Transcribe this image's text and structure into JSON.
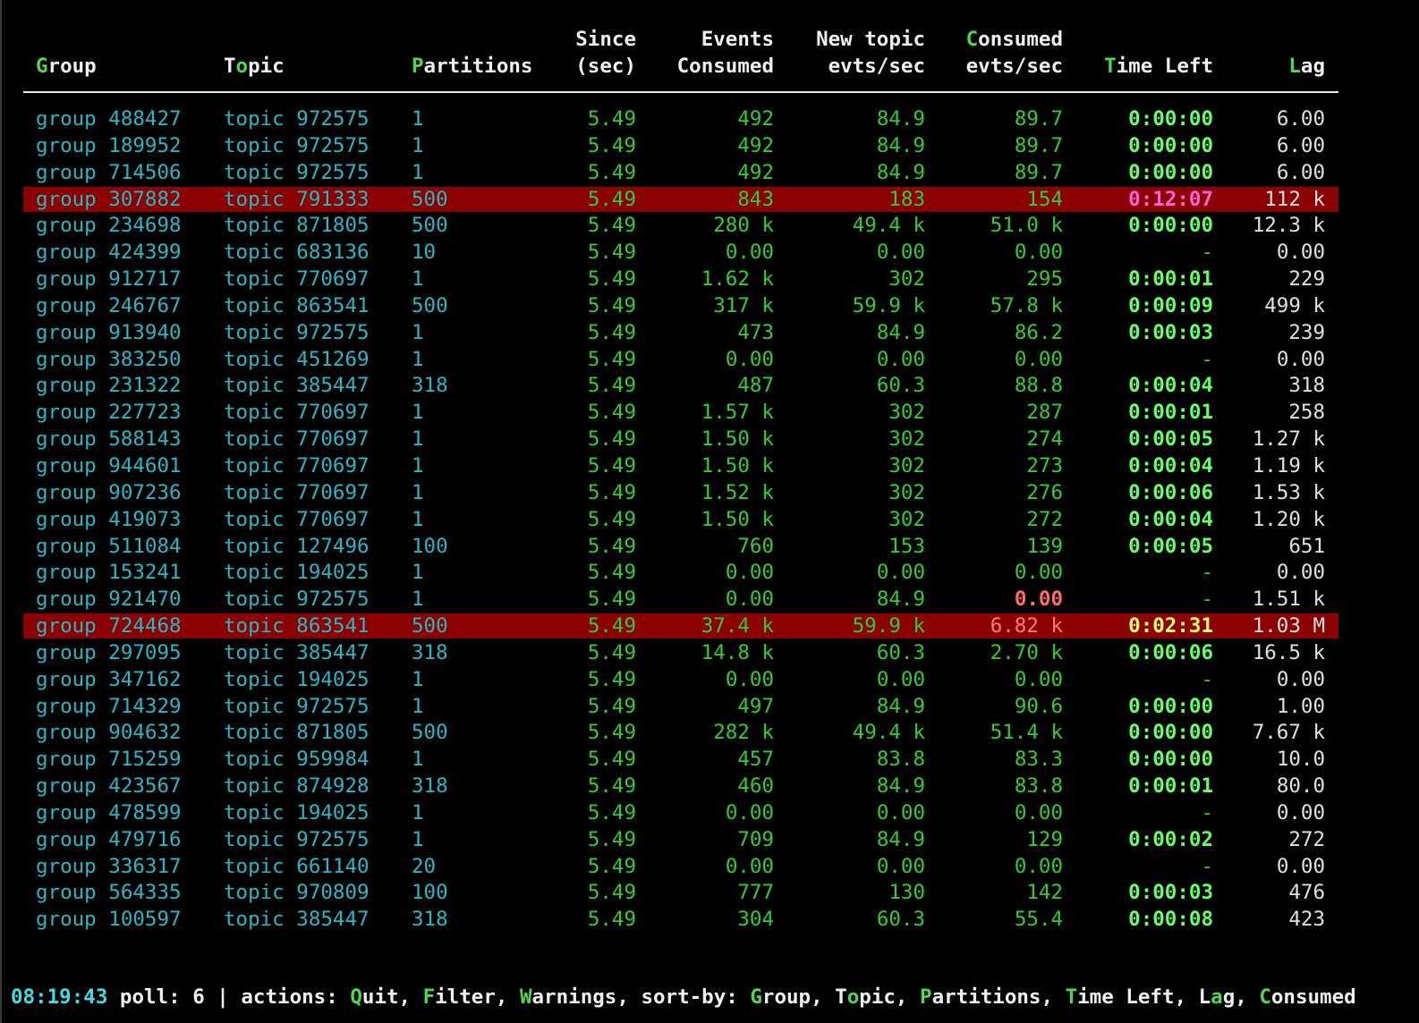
{
  "headers": {
    "group": "Group",
    "topic": "Topic",
    "partitions": "Partitions",
    "since_line1": "Since",
    "since_line2": "(sec)",
    "events_line1": "Events",
    "events_line2": "Consumed",
    "newtopic_line1": "New topic",
    "newtopic_line2": "evts/sec",
    "consumed_line1": "Consumed",
    "consumed_line2": "evts/sec",
    "timeleft": "Time Left",
    "lag": "Lag"
  },
  "rows": [
    {
      "group": "group 488427",
      "topic": "topic 972575",
      "partitions": "1",
      "since": "5.49",
      "events": "492",
      "new": "84.9",
      "consumed": "89.7",
      "timeleft": "0:00:00",
      "lag": "6.00",
      "warn": false
    },
    {
      "group": "group 189952",
      "topic": "topic 972575",
      "partitions": "1",
      "since": "5.49",
      "events": "492",
      "new": "84.9",
      "consumed": "89.7",
      "timeleft": "0:00:00",
      "lag": "6.00",
      "warn": false
    },
    {
      "group": "group 714506",
      "topic": "topic 972575",
      "partitions": "1",
      "since": "5.49",
      "events": "492",
      "new": "84.9",
      "consumed": "89.7",
      "timeleft": "0:00:00",
      "lag": "6.00",
      "warn": false
    },
    {
      "group": "group 307882",
      "topic": "topic 791333",
      "partitions": "500",
      "since": "5.49",
      "events": "843",
      "new": "183",
      "consumed": "154",
      "timeleft": "0:12:07",
      "lag": "112 k",
      "warn": true,
      "time_style": "magenta"
    },
    {
      "group": "group 234698",
      "topic": "topic 871805",
      "partitions": "500",
      "since": "5.49",
      "events": "280 k",
      "new": "49.4 k",
      "consumed": "51.0 k",
      "timeleft": "0:00:00",
      "lag": "12.3 k",
      "warn": false
    },
    {
      "group": "group 424399",
      "topic": "topic 683136",
      "partitions": "10",
      "since": "5.49",
      "events": "0.00",
      "new": "0.00",
      "consumed": "0.00",
      "timeleft": "-",
      "lag": "0.00",
      "warn": false
    },
    {
      "group": "group 912717",
      "topic": "topic 770697",
      "partitions": "1",
      "since": "5.49",
      "events": "1.62 k",
      "new": "302",
      "consumed": "295",
      "timeleft": "0:00:01",
      "lag": "229",
      "warn": false
    },
    {
      "group": "group 246767",
      "topic": "topic 863541",
      "partitions": "500",
      "since": "5.49",
      "events": "317 k",
      "new": "59.9 k",
      "consumed": "57.8 k",
      "timeleft": "0:00:09",
      "lag": "499 k",
      "warn": false
    },
    {
      "group": "group 913940",
      "topic": "topic 972575",
      "partitions": "1",
      "since": "5.49",
      "events": "473",
      "new": "84.9",
      "consumed": "86.2",
      "timeleft": "0:00:03",
      "lag": "239",
      "warn": false
    },
    {
      "group": "group 383250",
      "topic": "topic 451269",
      "partitions": "1",
      "since": "5.49",
      "events": "0.00",
      "new": "0.00",
      "consumed": "0.00",
      "timeleft": "-",
      "lag": "0.00",
      "warn": false
    },
    {
      "group": "group 231322",
      "topic": "topic 385447",
      "partitions": "318",
      "since": "5.49",
      "events": "487",
      "new": "60.3",
      "consumed": "88.8",
      "timeleft": "0:00:04",
      "lag": "318",
      "warn": false
    },
    {
      "group": "group 227723",
      "topic": "topic 770697",
      "partitions": "1",
      "since": "5.49",
      "events": "1.57 k",
      "new": "302",
      "consumed": "287",
      "timeleft": "0:00:01",
      "lag": "258",
      "warn": false
    },
    {
      "group": "group 588143",
      "topic": "topic 770697",
      "partitions": "1",
      "since": "5.49",
      "events": "1.50 k",
      "new": "302",
      "consumed": "274",
      "timeleft": "0:00:05",
      "lag": "1.27 k",
      "warn": false
    },
    {
      "group": "group 944601",
      "topic": "topic 770697",
      "partitions": "1",
      "since": "5.49",
      "events": "1.50 k",
      "new": "302",
      "consumed": "273",
      "timeleft": "0:00:04",
      "lag": "1.19 k",
      "warn": false
    },
    {
      "group": "group 907236",
      "topic": "topic 770697",
      "partitions": "1",
      "since": "5.49",
      "events": "1.52 k",
      "new": "302",
      "consumed": "276",
      "timeleft": "0:00:06",
      "lag": "1.53 k",
      "warn": false
    },
    {
      "group": "group 419073",
      "topic": "topic 770697",
      "partitions": "1",
      "since": "5.49",
      "events": "1.50 k",
      "new": "302",
      "consumed": "272",
      "timeleft": "0:00:04",
      "lag": "1.20 k",
      "warn": false
    },
    {
      "group": "group 511084",
      "topic": "topic 127496",
      "partitions": "100",
      "since": "5.49",
      "events": "760",
      "new": "153",
      "consumed": "139",
      "timeleft": "0:00:05",
      "lag": "651",
      "warn": false
    },
    {
      "group": "group 153241",
      "topic": "topic 194025",
      "partitions": "1",
      "since": "5.49",
      "events": "0.00",
      "new": "0.00",
      "consumed": "0.00",
      "timeleft": "-",
      "lag": "0.00",
      "warn": false
    },
    {
      "group": "group 921470",
      "topic": "topic 972575",
      "partitions": "1",
      "since": "5.49",
      "events": "0.00",
      "new": "84.9",
      "consumed": "0.00",
      "timeleft": "-",
      "lag": "1.51 k",
      "warn": false,
      "consumed_style": "alert"
    },
    {
      "group": "group 724468",
      "topic": "topic 863541",
      "partitions": "500",
      "since": "5.49",
      "events": "37.4 k",
      "new": "59.9 k",
      "consumed": "6.82 k",
      "timeleft": "0:02:31",
      "lag": "1.03 M",
      "warn": true,
      "time_style": "yellow",
      "consumed_style": "warnred"
    },
    {
      "group": "group 297095",
      "topic": "topic 385447",
      "partitions": "318",
      "since": "5.49",
      "events": "14.8 k",
      "new": "60.3",
      "consumed": "2.70 k",
      "timeleft": "0:00:06",
      "lag": "16.5 k",
      "warn": false
    },
    {
      "group": "group 347162",
      "topic": "topic 194025",
      "partitions": "1",
      "since": "5.49",
      "events": "0.00",
      "new": "0.00",
      "consumed": "0.00",
      "timeleft": "-",
      "lag": "0.00",
      "warn": false
    },
    {
      "group": "group 714329",
      "topic": "topic 972575",
      "partitions": "1",
      "since": "5.49",
      "events": "497",
      "new": "84.9",
      "consumed": "90.6",
      "timeleft": "0:00:00",
      "lag": "1.00",
      "warn": false
    },
    {
      "group": "group 904632",
      "topic": "topic 871805",
      "partitions": "500",
      "since": "5.49",
      "events": "282 k",
      "new": "49.4 k",
      "consumed": "51.4 k",
      "timeleft": "0:00:00",
      "lag": "7.67 k",
      "warn": false
    },
    {
      "group": "group 715259",
      "topic": "topic 959984",
      "partitions": "1",
      "since": "5.49",
      "events": "457",
      "new": "83.8",
      "consumed": "83.3",
      "timeleft": "0:00:00",
      "lag": "10.0",
      "warn": false
    },
    {
      "group": "group 423567",
      "topic": "topic 874928",
      "partitions": "318",
      "since": "5.49",
      "events": "460",
      "new": "84.9",
      "consumed": "83.8",
      "timeleft": "0:00:01",
      "lag": "80.0",
      "warn": false
    },
    {
      "group": "group 478599",
      "topic": "topic 194025",
      "partitions": "1",
      "since": "5.49",
      "events": "0.00",
      "new": "0.00",
      "consumed": "0.00",
      "timeleft": "-",
      "lag": "0.00",
      "warn": false
    },
    {
      "group": "group 479716",
      "topic": "topic 972575",
      "partitions": "1",
      "since": "5.49",
      "events": "709",
      "new": "84.9",
      "consumed": "129",
      "timeleft": "0:00:02",
      "lag": "272",
      "warn": false
    },
    {
      "group": "group 336317",
      "topic": "topic 661140",
      "partitions": "20",
      "since": "5.49",
      "events": "0.00",
      "new": "0.00",
      "consumed": "0.00",
      "timeleft": "-",
      "lag": "0.00",
      "warn": false
    },
    {
      "group": "group 564335",
      "topic": "topic 970809",
      "partitions": "100",
      "since": "5.49",
      "events": "777",
      "new": "130",
      "consumed": "142",
      "timeleft": "0:00:03",
      "lag": "476",
      "warn": false
    },
    {
      "group": "group 100597",
      "topic": "topic 385447",
      "partitions": "318",
      "since": "5.49",
      "events": "304",
      "new": "60.3",
      "consumed": "55.4",
      "timeleft": "0:00:08",
      "lag": "423",
      "warn": false
    }
  ],
  "status": {
    "clock": "08:19:43",
    "poll_label": "poll: 6",
    "separator": "|",
    "actions_label": "actions:",
    "actions": [
      {
        "key": "Q",
        "rest": "uit"
      },
      {
        "key": "F",
        "rest": "ilter"
      },
      {
        "key": "W",
        "rest": "arnings"
      }
    ],
    "sort_label": "sort-by:",
    "sorts": [
      {
        "pre": "",
        "key": "G",
        "rest": "roup"
      },
      {
        "pre": "T",
        "key": "o",
        "rest": "pic"
      },
      {
        "pre": "",
        "key": "P",
        "rest": "artitions"
      },
      {
        "pre": "",
        "key": "T",
        "rest": "ime Left"
      },
      {
        "pre": "L",
        "key": "a",
        "rest": "g"
      },
      {
        "pre": "",
        "key": "C",
        "rest": "onsumed"
      }
    ]
  },
  "colors": {
    "background": "#000000",
    "id_text": "#2ab7c4",
    "metric_text": "#33cc33",
    "time_ok": "#66ff66",
    "warning_row": "#8b0000",
    "hotkey": "#4fd84f"
  }
}
